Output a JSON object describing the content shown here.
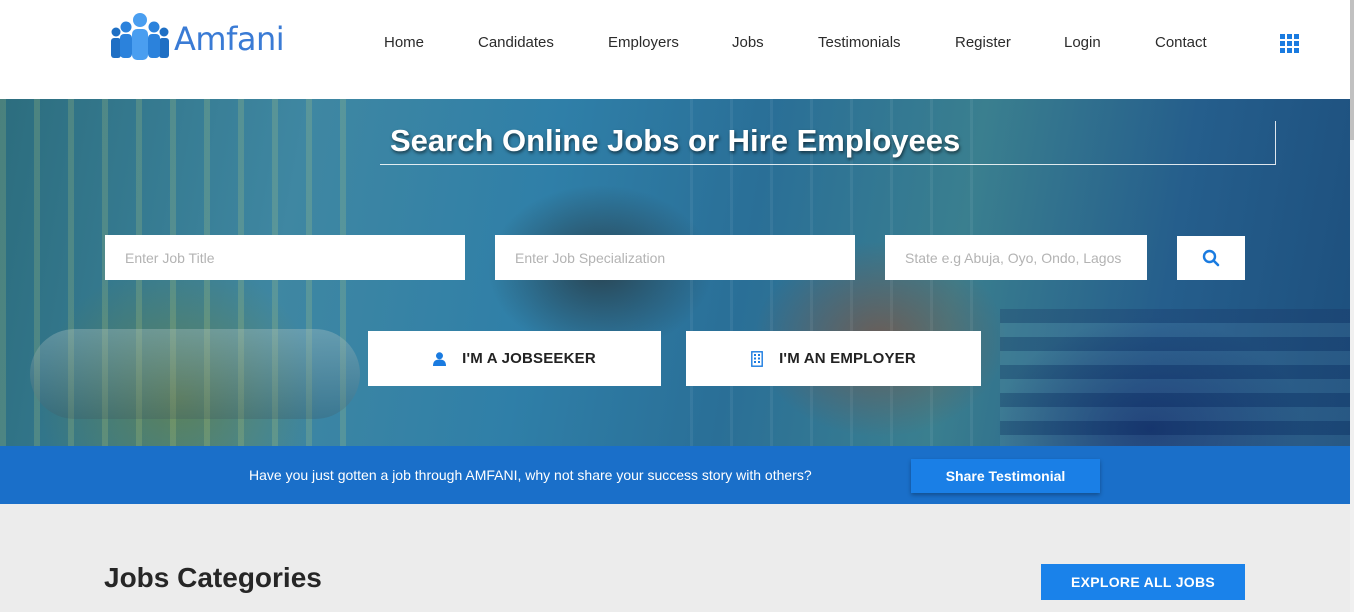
{
  "brand": {
    "name": "Amfani",
    "color": "#3a7bd5"
  },
  "nav": {
    "items": [
      {
        "label": "Home"
      },
      {
        "label": "Candidates"
      },
      {
        "label": "Employers"
      },
      {
        "label": "Jobs"
      },
      {
        "label": "Testimonials"
      },
      {
        "label": "Register"
      },
      {
        "label": "Login"
      },
      {
        "label": "Contact"
      }
    ],
    "menu_icon": "grid-icon"
  },
  "hero": {
    "title": "Search Online Jobs or Hire Employees",
    "job_title_placeholder": "Enter Job Title",
    "specialization_placeholder": "Enter Job Specialization",
    "state_placeholder": "State e.g Abuja, Oyo, Ondo, Lagos",
    "search_icon": "search-icon",
    "jobseeker_label": "I'M A JOBSEEKER",
    "employer_label": "I'M AN EMPLOYER",
    "accent": "#1a7be0"
  },
  "testimonial_bar": {
    "text": "Have you just gotten a job through AMFANI, why not share your success story with others?",
    "button_label": "Share Testimonial",
    "background": "#1a6fc9"
  },
  "jobs_section": {
    "title": "Jobs Categories",
    "explore_label": "EXPLORE ALL JOBS"
  }
}
